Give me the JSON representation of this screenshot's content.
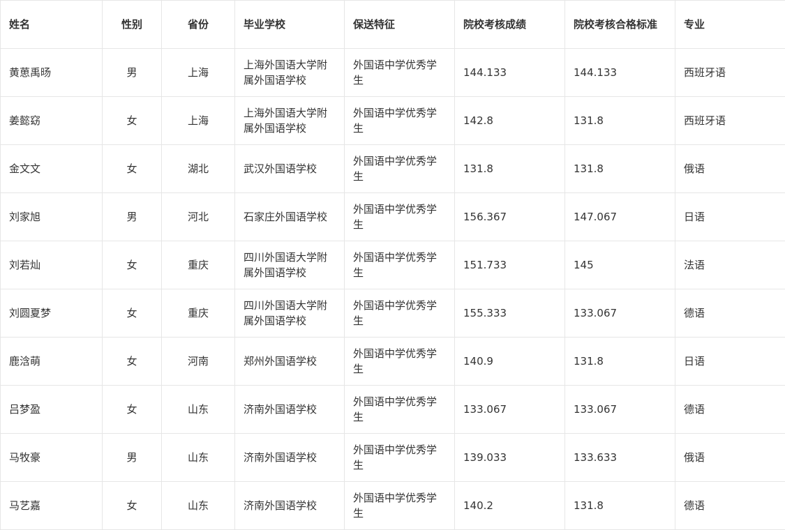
{
  "table": {
    "headers": {
      "name": "姓名",
      "gender": "性别",
      "province": "省份",
      "school": "毕业学校",
      "feature": "保送特征",
      "score": "院校考核成绩",
      "standard": "院校考核合格标准",
      "major": "专业"
    },
    "rows": [
      {
        "name": "黄葸禹旸",
        "gender": "男",
        "province": "上海",
        "school": "上海外国语大学附属外国语学校",
        "feature": "外国语中学优秀学生",
        "score": "144.133",
        "standard": "144.133",
        "major": "西班牙语"
      },
      {
        "name": "姜懿窈",
        "gender": "女",
        "province": "上海",
        "school": "上海外国语大学附属外国语学校",
        "feature": "外国语中学优秀学生",
        "score": "142.8",
        "standard": "131.8",
        "major": "西班牙语"
      },
      {
        "name": "金文文",
        "gender": "女",
        "province": "湖北",
        "school": "武汉外国语学校",
        "feature": "外国语中学优秀学生",
        "score": "131.8",
        "standard": "131.8",
        "major": "俄语"
      },
      {
        "name": "刘家旭",
        "gender": "男",
        "province": "河北",
        "school": "石家庄外国语学校",
        "feature": "外国语中学优秀学生",
        "score": "156.367",
        "standard": "147.067",
        "major": "日语"
      },
      {
        "name": "刘若灿",
        "gender": "女",
        "province": "重庆",
        "school": "四川外国语大学附属外国语学校",
        "feature": "外国语中学优秀学生",
        "score": "151.733",
        "standard": "145",
        "major": "法语"
      },
      {
        "name": "刘圆夏梦",
        "gender": "女",
        "province": "重庆",
        "school": "四川外国语大学附属外国语学校",
        "feature": "外国语中学优秀学生",
        "score": "155.333",
        "standard": "133.067",
        "major": "德语"
      },
      {
        "name": "鹿浛萌",
        "gender": "女",
        "province": "河南",
        "school": "郑州外国语学校",
        "feature": "外国语中学优秀学生",
        "score": "140.9",
        "standard": "131.8",
        "major": "日语"
      },
      {
        "name": "吕梦盈",
        "gender": "女",
        "province": "山东",
        "school": "济南外国语学校",
        "feature": "外国语中学优秀学生",
        "score": "133.067",
        "standard": "133.067",
        "major": "德语"
      },
      {
        "name": "马牧豪",
        "gender": "男",
        "province": "山东",
        "school": "济南外国语学校",
        "feature": "外国语中学优秀学生",
        "score": "139.033",
        "standard": "133.633",
        "major": "俄语"
      },
      {
        "name": "马艺嘉",
        "gender": "女",
        "province": "山东",
        "school": "济南外国语学校",
        "feature": "外国语中学优秀学生",
        "score": "140.2",
        "standard": "131.8",
        "major": "德语"
      }
    ]
  }
}
